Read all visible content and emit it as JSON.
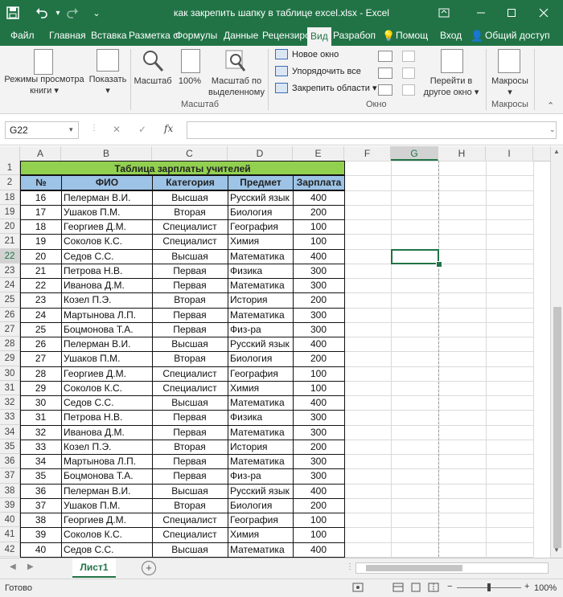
{
  "window": {
    "title": "как закрепить шапку в таблице excel.xlsx - Excel",
    "icons": {
      "save": "save-icon",
      "undo": "undo-icon",
      "redo": "redo-icon",
      "customize": "customize-qat-icon",
      "ribbon_options": "ribbon-display-icon",
      "minimize": "minimize-icon",
      "maximize": "maximize-icon",
      "close": "close-icon"
    }
  },
  "tabs": [
    "Файл",
    "Главная",
    "Вставка",
    "Разметка с",
    "Формулы",
    "Данные",
    "Рецензиро",
    "Вид",
    "Разрабоп",
    "Помощ",
    "Вход",
    "Общий доступ"
  ],
  "active_tab": "Вид",
  "ribbon": {
    "views_btn": "Режимы просмотра книги",
    "show_btn": "Показать",
    "zoom_btn": "Масштаб",
    "zoom100_btn": "100%",
    "zoom_sel_btn": "Масштаб по выделенному",
    "zoom_group": "Масштаб",
    "new_window": "Новое окно",
    "arrange_all": "Упорядочить все",
    "freeze_panes": "Закрепить области",
    "window_group": "Окно",
    "switch_windows": "Перейти в другое окно",
    "macros_btn": "Макросы",
    "macros_group": "Макросы"
  },
  "formula_bar": {
    "name_box": "G22",
    "fx": "fx",
    "cancel": "✕",
    "enter": "✓"
  },
  "columns": [
    "A",
    "B",
    "C",
    "D",
    "E",
    "F",
    "G",
    "H",
    "I"
  ],
  "selected_column": "G",
  "rows": [
    "1",
    "2",
    "18",
    "19",
    "20",
    "21",
    "22",
    "23",
    "24",
    "25",
    "26",
    "27",
    "28",
    "29",
    "30",
    "31",
    "32",
    "33",
    "34",
    "35",
    "36",
    "37",
    "38",
    "39",
    "40",
    "41",
    "42"
  ],
  "selected_row": "22",
  "table": {
    "caption": "Таблица зарплаты учителей",
    "headers": [
      "№",
      "ФИО",
      "Категория",
      "Предмет",
      "Зарплата"
    ],
    "rows": [
      [
        "16",
        "Пелерман В.И.",
        "Высшая",
        "Русский язык",
        "400"
      ],
      [
        "17",
        "Ушаков П.М.",
        "Вторая",
        "Биология",
        "200"
      ],
      [
        "18",
        "Георгиев Д.М.",
        "Специалист",
        "География",
        "100"
      ],
      [
        "19",
        "Соколов К.С.",
        "Специалист",
        "Химия",
        "100"
      ],
      [
        "20",
        "Седов С.С.",
        "Высшая",
        "Математика",
        "400"
      ],
      [
        "21",
        "Петрова Н.В.",
        "Первая",
        "Физика",
        "300"
      ],
      [
        "22",
        "Иванова Д.М.",
        "Первая",
        "Математика",
        "300"
      ],
      [
        "23",
        "Козел П.Э.",
        "Вторая",
        "История",
        "200"
      ],
      [
        "24",
        "Мартынова Л.П.",
        "Первая",
        "Математика",
        "300"
      ],
      [
        "25",
        "Боцмонова Т.А.",
        "Первая",
        "Физ-ра",
        "300"
      ],
      [
        "26",
        "Пелерман В.И.",
        "Высшая",
        "Русский язык",
        "400"
      ],
      [
        "27",
        "Ушаков П.М.",
        "Вторая",
        "Биология",
        "200"
      ],
      [
        "28",
        "Георгиев Д.М.",
        "Специалист",
        "География",
        "100"
      ],
      [
        "29",
        "Соколов К.С.",
        "Специалист",
        "Химия",
        "100"
      ],
      [
        "30",
        "Седов С.С.",
        "Высшая",
        "Математика",
        "400"
      ],
      [
        "31",
        "Петрова Н.В.",
        "Первая",
        "Физика",
        "300"
      ],
      [
        "32",
        "Иванова Д.М.",
        "Первая",
        "Математика",
        "300"
      ],
      [
        "33",
        "Козел П.Э.",
        "Вторая",
        "История",
        "200"
      ],
      [
        "34",
        "Мартынова Л.П.",
        "Первая",
        "Математика",
        "300"
      ],
      [
        "35",
        "Боцмонова Т.А.",
        "Первая",
        "Физ-ра",
        "300"
      ],
      [
        "36",
        "Пелерман В.И.",
        "Высшая",
        "Русский язык",
        "400"
      ],
      [
        "37",
        "Ушаков П.М.",
        "Вторая",
        "Биология",
        "200"
      ],
      [
        "38",
        "Георгиев Д.М.",
        "Специалист",
        "География",
        "100"
      ],
      [
        "39",
        "Соколов К.С.",
        "Специалист",
        "Химия",
        "100"
      ],
      [
        "40",
        "Седов С.С.",
        "Высшая",
        "Математика",
        "400"
      ]
    ]
  },
  "sheet_tab": "Лист1",
  "status": {
    "ready": "Готово",
    "zoom": "100%",
    "minus": "−",
    "plus": "+"
  },
  "colors": {
    "accent": "#217346",
    "caption_fill": "#92d050",
    "header_fill": "#9dc3e6"
  }
}
